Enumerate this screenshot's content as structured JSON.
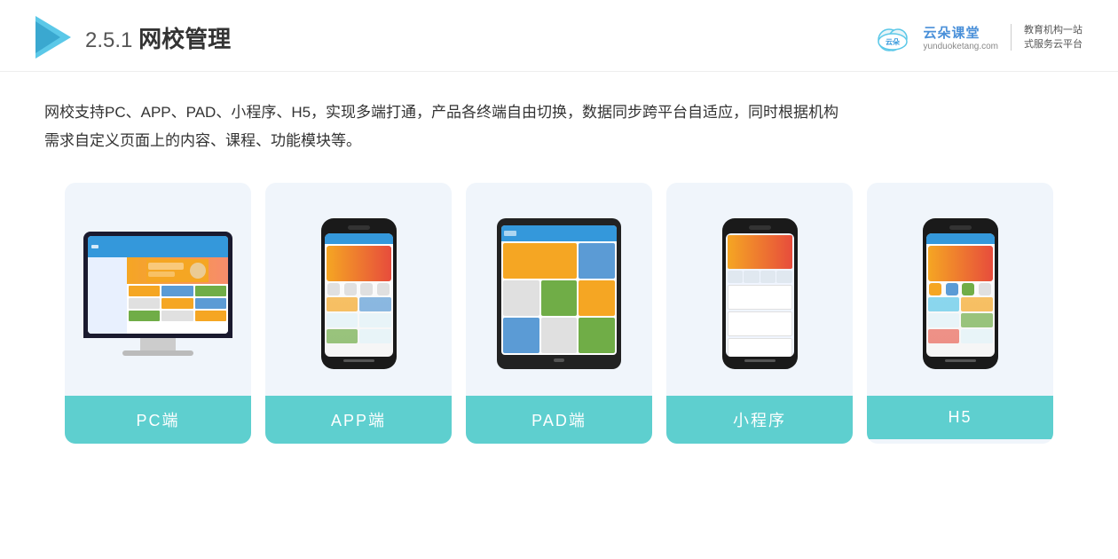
{
  "header": {
    "section_number": "2.5.1",
    "section_title": "网校管理",
    "brand": {
      "name": "云朵课堂",
      "url": "yunduoketang.com",
      "slogan_line1": "教育机构一站",
      "slogan_line2": "式服务云平台"
    }
  },
  "description": {
    "text_line1": "网校支持PC、APP、PAD、小程序、H5，实现多端打通，产品各终端自由切换，数据同步跨平台自适应，同时根据机构",
    "text_line2": "需求自定义页面上的内容、课程、功能模块等。"
  },
  "devices": [
    {
      "id": "pc",
      "label": "PC端",
      "type": "pc"
    },
    {
      "id": "app",
      "label": "APP端",
      "type": "phone"
    },
    {
      "id": "pad",
      "label": "PAD端",
      "type": "tablet"
    },
    {
      "id": "mini",
      "label": "小程序",
      "type": "mini-phone"
    },
    {
      "id": "h5",
      "label": "H5",
      "type": "phone2"
    }
  ],
  "colors": {
    "card_bg": "#eef3fa",
    "label_bg": "#5ecfcf",
    "label_text": "#ffffff",
    "accent_blue": "#3498db",
    "accent_orange": "#f5a623"
  }
}
